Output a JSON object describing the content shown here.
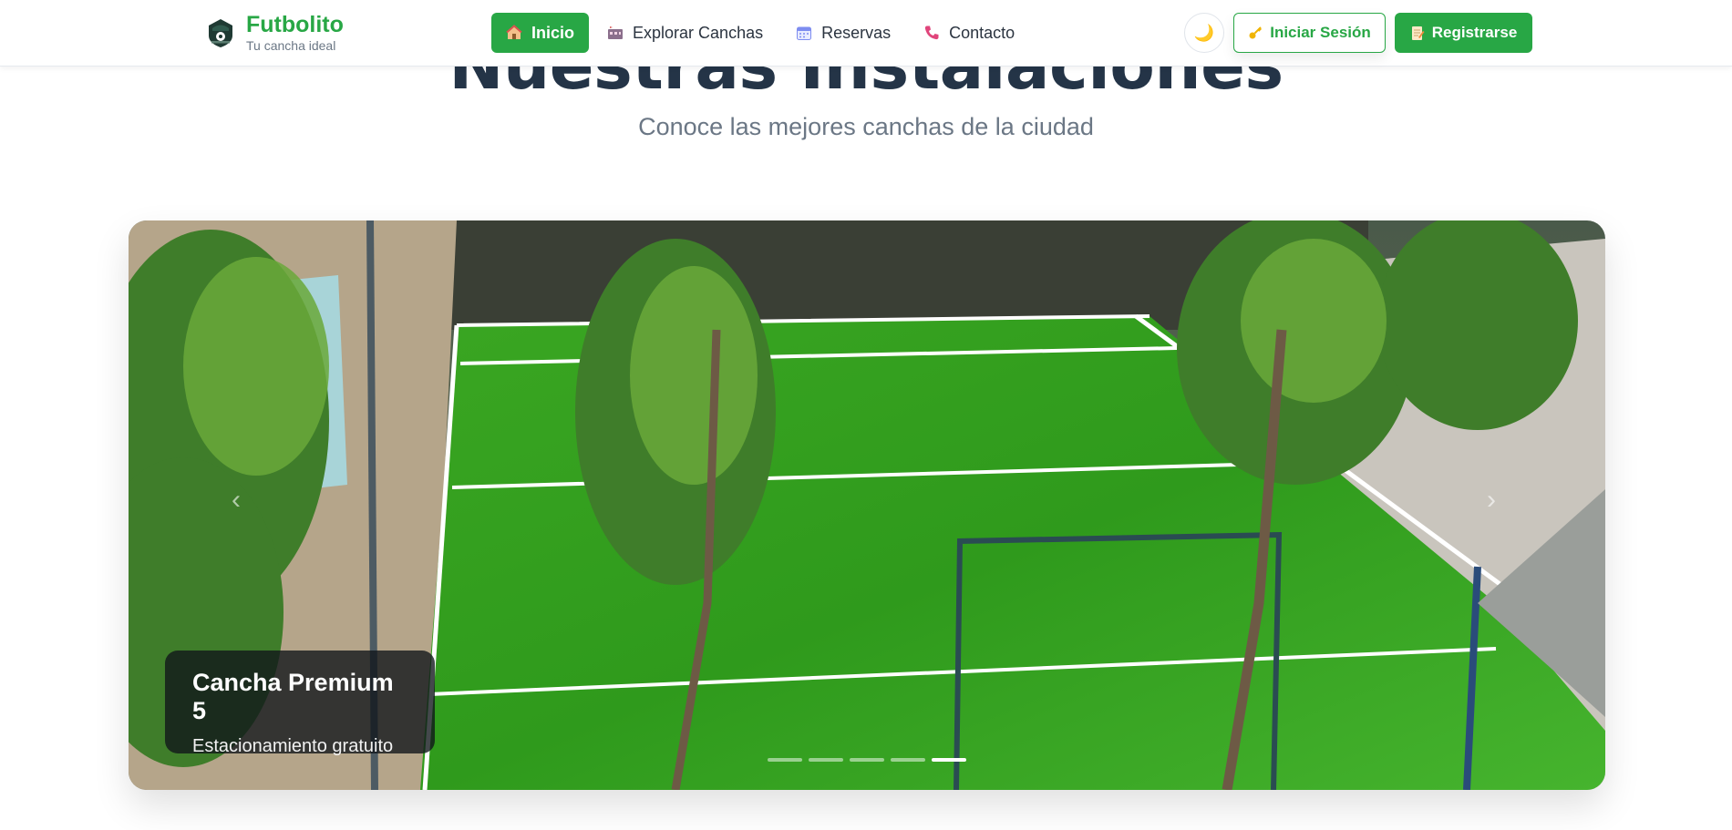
{
  "brand": {
    "name": "Futbolito",
    "tagline": "Tu cancha ideal"
  },
  "nav": {
    "items": [
      {
        "label": "Inicio",
        "icon": "home-icon",
        "active": true
      },
      {
        "label": "Explorar Canchas",
        "icon": "stadium-icon",
        "active": false
      },
      {
        "label": "Reservas",
        "icon": "calendar-icon",
        "active": false
      },
      {
        "label": "Contacto",
        "icon": "phone-icon",
        "active": false
      }
    ]
  },
  "actions": {
    "theme_icon": "moon-icon",
    "login_label": "Iniciar Sesión",
    "register_label": "Registrarse"
  },
  "section": {
    "title": "Nuestras Instalaciones",
    "subtitle": "Conoce las mejores canchas de la ciudad"
  },
  "carousel": {
    "slide_count": 5,
    "active_slide": 5,
    "caption_title": "Cancha Premium 5",
    "caption_text": "Estacionamiento gratuito"
  },
  "colors": {
    "brand_green": "#28a745",
    "title_dark": "#243447",
    "subtitle_gray": "#6b7785"
  }
}
